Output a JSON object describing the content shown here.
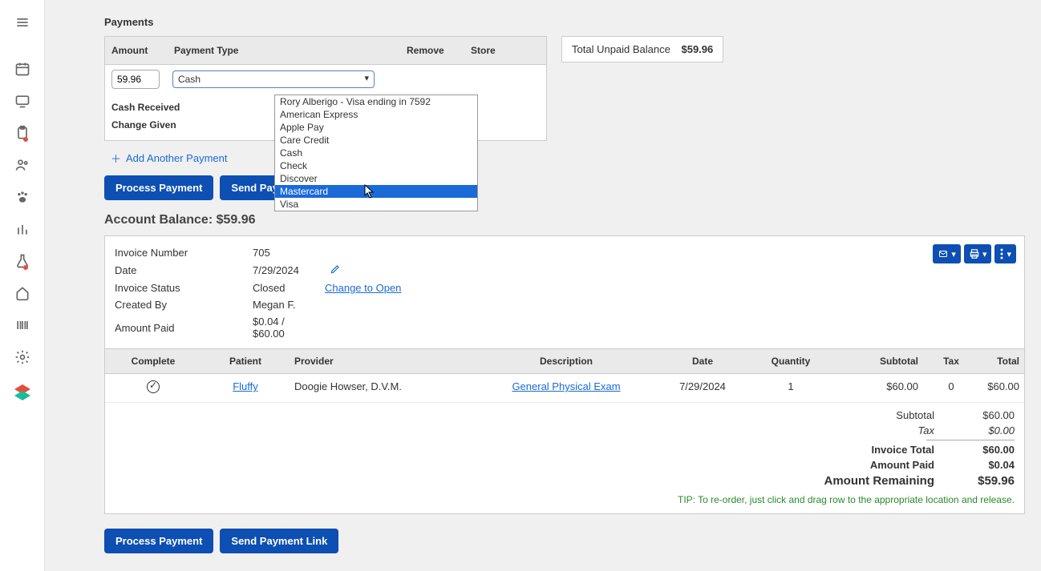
{
  "section_title": "Payments",
  "pay_table": {
    "headers": {
      "amount": "Amount",
      "type": "Payment Type",
      "remove": "Remove",
      "store": "Store"
    },
    "amount_value": "59.96",
    "selected_type": "Cash",
    "cash_received_label": "Cash Received",
    "change_given_label": "Change Given"
  },
  "dropdown": {
    "options": [
      "Rory Alberigo - Visa ending in 7592",
      "American Express",
      "Apple Pay",
      "Care Credit",
      "Cash",
      "Check",
      "Discover",
      "Mastercard",
      "Visa"
    ],
    "highlight_index": 7
  },
  "unpaid": {
    "label": "Total Unpaid Balance",
    "amount": "$59.96"
  },
  "add_another": "Add Another Payment",
  "buttons": {
    "process": "Process Payment",
    "send_link": "Send Payment Link"
  },
  "balance": {
    "label": "Account Balance:",
    "amount": "$59.96"
  },
  "invoice": {
    "meta": {
      "invoice_number_k": "Invoice Number",
      "invoice_number_v": "705",
      "date_k": "Date",
      "date_v": "7/29/2024",
      "status_k": "Invoice Status",
      "status_v": "Closed",
      "change_open": "Change to Open",
      "created_k": "Created By",
      "created_v": "Megan F.",
      "paid_k": "Amount Paid",
      "paid_v1": "$0.04 /",
      "paid_v2": "$60.00"
    },
    "line_headers": {
      "complete": "Complete",
      "patient": "Patient",
      "provider": "Provider",
      "description": "Description",
      "date": "Date",
      "quantity": "Quantity",
      "subtotal": "Subtotal",
      "tax": "Tax",
      "total": "Total"
    },
    "lines": [
      {
        "patient": "Fluffy",
        "provider": "Doogie Howser, D.V.M.",
        "description": "General Physical Exam",
        "date": "7/29/2024",
        "quantity": "1",
        "subtotal": "$60.00",
        "tax": "0",
        "total": "$60.00"
      }
    ],
    "totals": {
      "subtotal_k": "Subtotal",
      "subtotal_v": "$60.00",
      "tax_k": "Tax",
      "tax_v": "$0.00",
      "invoice_total_k": "Invoice Total",
      "invoice_total_v": "$60.00",
      "amount_paid_k": "Amount Paid",
      "amount_paid_v": "$0.04",
      "remaining_k": "Amount Remaining",
      "remaining_v": "$59.96"
    },
    "tip": "TIP: To re-order, just click and drag row to the appropriate location and release."
  }
}
